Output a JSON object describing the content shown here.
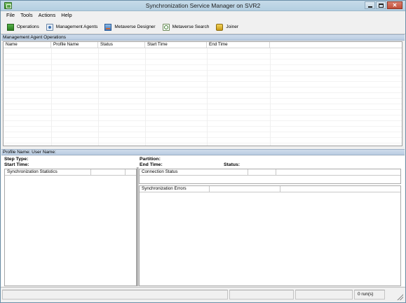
{
  "window": {
    "title": "Synchronization Service Manager on SVR2",
    "controls": {
      "minimize": "minimize-icon",
      "maximize": "maximize-icon",
      "close": "✕"
    }
  },
  "menu": [
    "File",
    "Tools",
    "Actions",
    "Help"
  ],
  "toolbar": [
    {
      "label": "Operations",
      "icon": "operations-icon"
    },
    {
      "label": "Management Agents",
      "icon": "management-agents-icon"
    },
    {
      "label": "Metaverse Designer",
      "icon": "metaverse-designer-icon"
    },
    {
      "label": "Metaverse Search",
      "icon": "metaverse-search-icon"
    },
    {
      "label": "Joiner",
      "icon": "joiner-icon"
    }
  ],
  "operations": {
    "header": "Management Agent Operations",
    "columns": [
      "Name",
      "Profile Name",
      "Status",
      "Start Time",
      "End Time"
    ]
  },
  "details": {
    "profile_bar": "Profile Name:   User Name:",
    "step_type": "Step Type:",
    "start_time": "Start Time:",
    "partition": "Partition:",
    "end_time": "End Time:",
    "status": "Status:",
    "sync_stats": "Synchronization Statistics",
    "connection_status": "Connection Status",
    "sync_errors": "Synchronization Errors"
  },
  "statusbar": {
    "runs": "0 run(s)"
  },
  "colors": {
    "titlebar": "#c6dbe9",
    "section_header": "#cfdceb",
    "window_bg": "#f0f0f0"
  }
}
